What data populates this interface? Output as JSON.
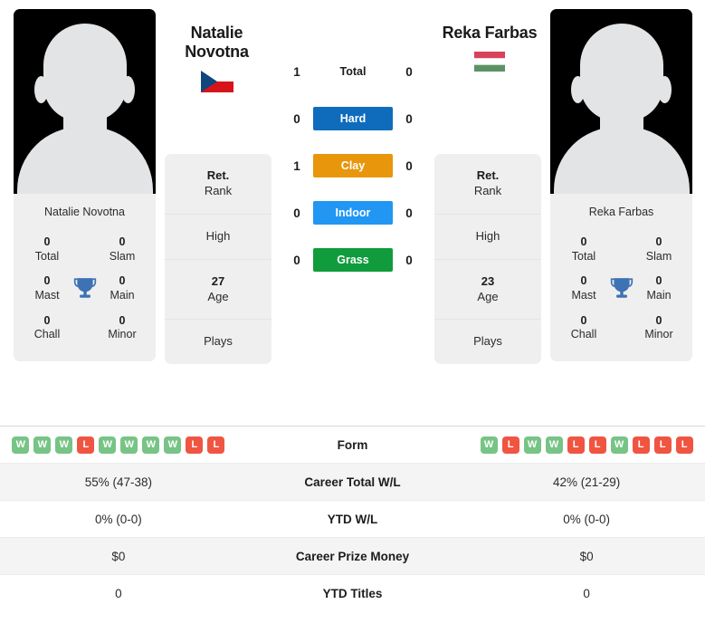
{
  "players": {
    "left": {
      "first_name": "Natalie",
      "last_name": "Novotna",
      "full_name": "Natalie Novotna",
      "country_flag": "czech-republic-flag",
      "titles": {
        "total": "0",
        "total_label": "Total",
        "slam": "0",
        "slam_label": "Slam",
        "mast": "0",
        "mast_label": "Mast",
        "main": "0",
        "main_label": "Main",
        "chall": "0",
        "chall_label": "Chall",
        "minor": "0",
        "minor_label": "Minor"
      },
      "info": {
        "rank_value": "Ret.",
        "rank_label": "Rank",
        "high_value": "",
        "high_label": "High",
        "age_value": "27",
        "age_label": "Age",
        "plays_value": "",
        "plays_label": "Plays"
      }
    },
    "right": {
      "first_name": "Reka",
      "last_name": "Farbas",
      "full_name": "Reka Farbas",
      "country_flag": "hungary-flag",
      "titles": {
        "total": "0",
        "total_label": "Total",
        "slam": "0",
        "slam_label": "Slam",
        "mast": "0",
        "mast_label": "Mast",
        "main": "0",
        "main_label": "Main",
        "chall": "0",
        "chall_label": "Chall",
        "minor": "0",
        "minor_label": "Minor"
      },
      "info": {
        "rank_value": "Ret.",
        "rank_label": "Rank",
        "high_value": "",
        "high_label": "High",
        "age_value": "23",
        "age_label": "Age",
        "plays_value": "",
        "plays_label": "Plays"
      }
    }
  },
  "head_to_head": [
    {
      "surface": "Total",
      "left": "1",
      "right": "0",
      "color": "transparent",
      "text_color": "#1c1c1c"
    },
    {
      "surface": "Hard",
      "left": "0",
      "right": "0",
      "color": "#0f6cbd",
      "text_color": "#ffffff"
    },
    {
      "surface": "Clay",
      "left": "1",
      "right": "0",
      "color": "#e8960c",
      "text_color": "#ffffff"
    },
    {
      "surface": "Indoor",
      "left": "0",
      "right": "0",
      "color": "#2196f3",
      "text_color": "#ffffff"
    },
    {
      "surface": "Grass",
      "left": "0",
      "right": "0",
      "color": "#109c3c",
      "text_color": "#ffffff"
    }
  ],
  "stats_rows": [
    {
      "label": "Form",
      "type": "form",
      "left_form": [
        "W",
        "W",
        "W",
        "L",
        "W",
        "W",
        "W",
        "W",
        "L",
        "L"
      ],
      "right_form": [
        "W",
        "L",
        "W",
        "W",
        "L",
        "L",
        "W",
        "L",
        "L",
        "L"
      ],
      "left": "",
      "right": ""
    },
    {
      "label": "Career Total W/L",
      "type": "text",
      "left": "55% (47-38)",
      "right": "42% (21-29)"
    },
    {
      "label": "YTD W/L",
      "type": "text",
      "left": "0% (0-0)",
      "right": "0% (0-0)"
    },
    {
      "label": "Career Prize Money",
      "type": "text",
      "left": "$0",
      "right": "$0"
    },
    {
      "label": "YTD Titles",
      "type": "text",
      "left": "0",
      "right": "0"
    }
  ],
  "colors": {
    "win_badge": "#77c486",
    "loss_badge": "#f05542",
    "hard": "#0f6cbd",
    "clay": "#e8960c",
    "indoor": "#2196f3",
    "grass": "#109c3c",
    "trophy": "#3d72b4",
    "panel_bg": "#efefef"
  }
}
